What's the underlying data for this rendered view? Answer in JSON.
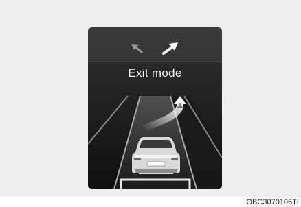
{
  "display": {
    "mode_text": "Exit mode",
    "icons": {
      "left_arrow": "arrow-up-left-icon",
      "right_arrow": "arrow-up-right-icon",
      "route": "lane-exit-route-icon",
      "vehicle": "car-rear-icon"
    },
    "colors": {
      "screen": "#232323",
      "text": "#f2f2f2",
      "active_arrow": "#ffffff",
      "inactive_arrow": "#9a9a9a"
    }
  },
  "figure_code": "OBC3070106TL"
}
